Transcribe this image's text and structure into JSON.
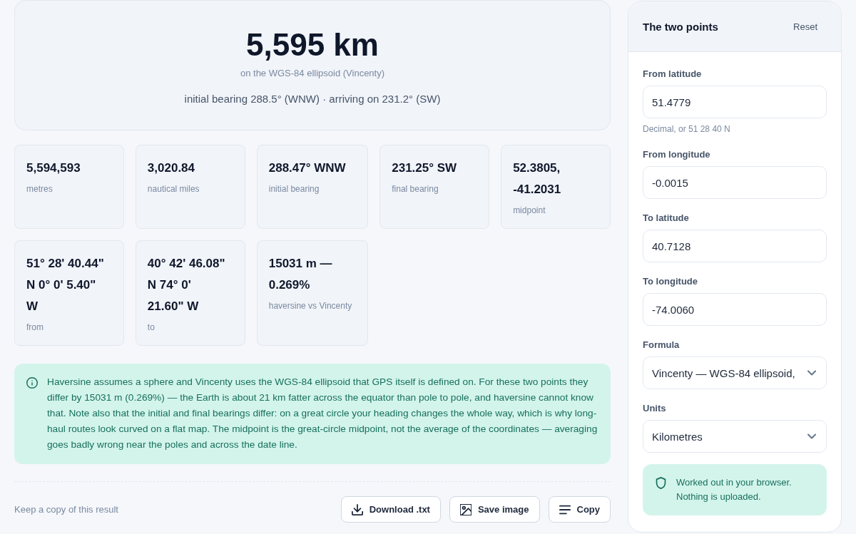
{
  "summary": {
    "distance": "5,595 km",
    "method": "on the WGS-84 ellipsoid (Vincenty)",
    "bearings": "initial bearing 288.5° (WNW) · arriving on 231.2° (SW)"
  },
  "stats": [
    {
      "value": "5,594,593",
      "label": "metres"
    },
    {
      "value": "3,020.84",
      "label": "nautical miles"
    },
    {
      "value": "288.47° WNW",
      "label": "initial bearing"
    },
    {
      "value": "231.25° SW",
      "label": "final bearing"
    },
    {
      "value": "52.3805, -41.2031",
      "label": "midpoint"
    },
    {
      "value": "51° 28' 40.44\" N 0° 0' 5.40\" W",
      "label": "from"
    },
    {
      "value": "40° 42' 46.08\" N 74° 0' 21.60\" W",
      "label": "to"
    },
    {
      "value": "15031 m — 0.269%",
      "label": "haversine vs Vincenty"
    }
  ],
  "note": "Haversine assumes a sphere and Vincenty uses the WGS-84 ellipsoid that GPS itself is defined on. For these two points they differ by 15031 m (0.269%) — the Earth is about 21 km fatter across the equator than pole to pole, and haversine cannot know that. Note also that the initial and final bearings differ: on a great circle your heading changes the whole way, which is why long-haul routes look curved on a flat map. The midpoint is the great-circle midpoint, not the average of the coordinates — averaging goes badly wrong near the poles and across the date line.",
  "export": {
    "caption": "Keep a copy of this result",
    "buttons": [
      {
        "label": "Download .txt",
        "kind": "download"
      },
      {
        "label": "Save image",
        "kind": "image"
      },
      {
        "label": "Copy",
        "kind": "copy"
      }
    ]
  },
  "panel": {
    "title": "The two points",
    "reset": "Reset",
    "fields": [
      {
        "kind": "input",
        "label": "From latitude",
        "value": "51.4779",
        "hint": "Decimal, or 51 28 40 N"
      },
      {
        "kind": "input",
        "label": "From longitude",
        "value": "-0.0015"
      },
      {
        "kind": "input",
        "label": "To latitude",
        "value": "40.7128"
      },
      {
        "kind": "input",
        "label": "To longitude",
        "value": "-74.0060"
      },
      {
        "kind": "select",
        "label": "Formula",
        "value": "Vincenty — WGS-84 ellipsoid,"
      },
      {
        "kind": "select",
        "label": "Units",
        "value": "Kilometres"
      }
    ],
    "notice": "Worked out in your browser. Nothing is uploaded."
  }
}
